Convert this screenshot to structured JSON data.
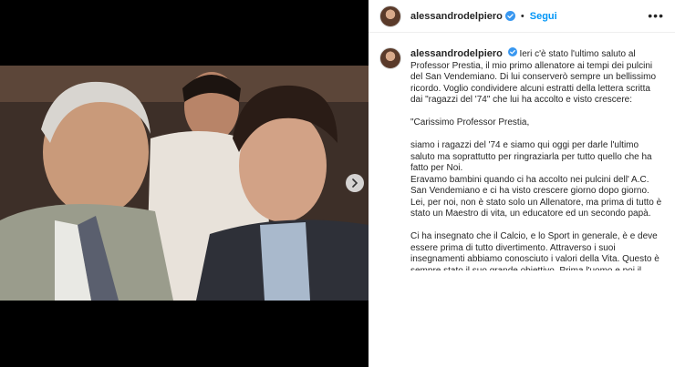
{
  "post": {
    "username": "alessandrodelpiero",
    "follow_label": "Segui",
    "separator": "•",
    "more_label": "•••",
    "caption_intro": "Ieri c'è stato l'ultimo saluto al Professor Prestia, il mio primo allenatore ai tempi dei pulcini del San Vendemiano. Di lui conserverò sempre un bellissimo ricordo. Voglio condividere alcuni estratti della lettera scritta dai \"ragazzi del '74\" che lui ha accolto e visto crescere:",
    "caption_greeting": "\"Carissimo Professor Prestia,",
    "caption_p1": "siamo i ragazzi del '74 e siamo qui oggi per darle l'ultimo saluto ma soprattutto per ringraziarla per tutto quello che ha fatto per Noi.",
    "caption_p2": "Eravamo bambini quando ci ha accolto nei pulcini dell' A.C. San Vendemiano e ci ha visto crescere giorno dopo giorno. Lei, per noi, non è stato solo un Allenatore, ma prima di tutto è stato un Maestro di vita, un educatore ed un secondo papà.",
    "caption_p3": "Ci ha insegnato che il Calcio, e lo Sport in generale, è e deve essere prima di tutto divertimento. Attraverso i suoi insegnamenti abbiamo conosciuto i valori della Vita. Questo è sempre stato il suo grande obiettivo. Prima l'uomo e poi il"
  },
  "colors": {
    "accent": "#0095f6",
    "verified": "#3897f0",
    "text": "#262626"
  }
}
